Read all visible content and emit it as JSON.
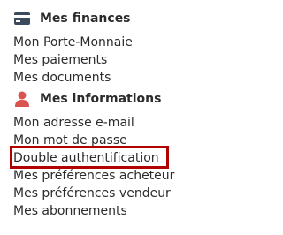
{
  "finances": {
    "title": "Mes finances",
    "icon": "credit-card-icon",
    "icon_color": "#3a4a5c",
    "items": [
      {
        "label": "Mon Porte-Monnaie"
      },
      {
        "label": "Mes paiements"
      },
      {
        "label": "Mes documents"
      }
    ]
  },
  "informations": {
    "title": "Mes informations",
    "icon": "user-icon",
    "icon_color": "#d9534f",
    "items": [
      {
        "label": "Mon adresse e-mail"
      },
      {
        "label": "Mon mot de passe"
      },
      {
        "label": "Double authentification",
        "highlighted": true
      },
      {
        "label": "Mes préférences acheteur"
      },
      {
        "label": "Mes préférences vendeur"
      },
      {
        "label": "Mes abonnements"
      }
    ]
  },
  "colors": {
    "text": "#2b2b2b",
    "highlight_border": "#b00000"
  }
}
